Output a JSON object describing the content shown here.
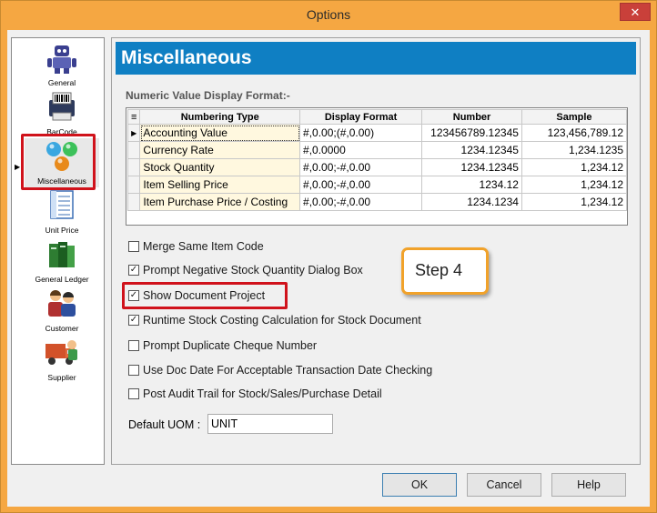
{
  "window": {
    "title": "Options",
    "close_glyph": "✕"
  },
  "nav": {
    "items": [
      {
        "label": "General",
        "icon": "robot-icon"
      },
      {
        "label": "BarCode",
        "icon": "barcode-printer-icon"
      },
      {
        "label": "Miscellaneous",
        "icon": "colored-spheres-icon",
        "selected": true
      },
      {
        "label": "Unit Price",
        "icon": "price-list-icon"
      },
      {
        "label": "General Ledger",
        "icon": "ledger-books-icon"
      },
      {
        "label": "Customer",
        "icon": "customers-icon"
      },
      {
        "label": "Supplier",
        "icon": "delivery-truck-icon"
      }
    ]
  },
  "panel": {
    "header": "Miscellaneous",
    "section_title": "Numeric Value Display Format:-",
    "table": {
      "headers": [
        "Numbering Type",
        "Display Format",
        "Number",
        "Sample"
      ],
      "rows": [
        [
          "Accounting Value",
          "#,0.00;(#,0.00)",
          "123456789.12345",
          "123,456,789.12"
        ],
        [
          "Currency Rate",
          "#,0.0000",
          "1234.12345",
          "1,234.1235"
        ],
        [
          "Stock Quantity",
          "#,0.00;-#,0.00",
          "1234.12345",
          "1,234.12"
        ],
        [
          "Item Selling Price",
          "#,0.00;-#,0.00",
          "1234.12",
          "1,234.12"
        ],
        [
          "Item Purchase Price / Costing",
          "#,0.00;-#,0.00",
          "1234.1234",
          "1,234.12"
        ]
      ]
    },
    "options": [
      {
        "label": "Merge Same Item Code",
        "checked": false
      },
      {
        "label": "Prompt Negative Stock Quantity Dialog Box",
        "checked": true
      },
      {
        "label": "Show Document Project",
        "checked": true
      },
      {
        "label": "Runtime Stock Costing Calculation for Stock Document",
        "checked": true
      },
      {
        "label": "Prompt Duplicate Cheque Number",
        "checked": false
      },
      {
        "label": "Use Doc Date For Acceptable Transaction Date Checking",
        "checked": false
      },
      {
        "label": "Post Audit Trail for Stock/Sales/Purchase Detail",
        "checked": false
      }
    ],
    "default_uom": {
      "label": "Default UOM :",
      "value": "UNIT"
    },
    "callout": "Step 4"
  },
  "buttons": {
    "ok": "OK",
    "cancel": "Cancel",
    "help": "Help"
  },
  "colors": {
    "header_blue": "#0f7fc3",
    "frame_orange": "#f5a742",
    "highlight_red": "#d0121b",
    "callout_border": "#f1a22a"
  }
}
